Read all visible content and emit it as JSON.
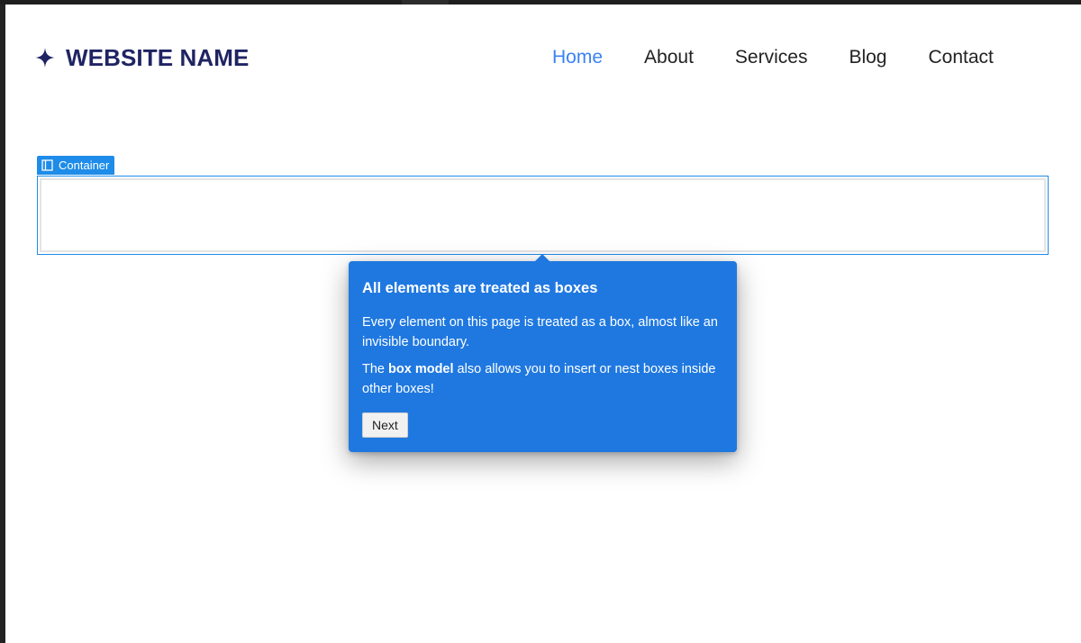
{
  "site": {
    "brand_name": "WEBSITE NAME",
    "brand_icon": "sparkle-star-icon",
    "brand_color": "#1f2463"
  },
  "nav": {
    "items": [
      {
        "label": "Home",
        "active": true
      },
      {
        "label": "About",
        "active": false
      },
      {
        "label": "Services",
        "active": false
      },
      {
        "label": "Blog",
        "active": false
      },
      {
        "label": "Contact",
        "active": false
      }
    ],
    "active_color": "#3b82f6"
  },
  "editor": {
    "container_label": "Container",
    "container_icon": "layout-panel-icon",
    "selection_color": "#1e8ce8"
  },
  "tour": {
    "title": "All elements are treated as boxes",
    "paragraph1": "Every element on this page is treated as a box, almost like an invisible boundary.",
    "paragraph2_prefix": "The ",
    "paragraph2_bold": "box model",
    "paragraph2_suffix": " also allows you to insert or nest boxes inside other boxes!",
    "next_label": "Next",
    "background_color": "#1f78e0"
  }
}
